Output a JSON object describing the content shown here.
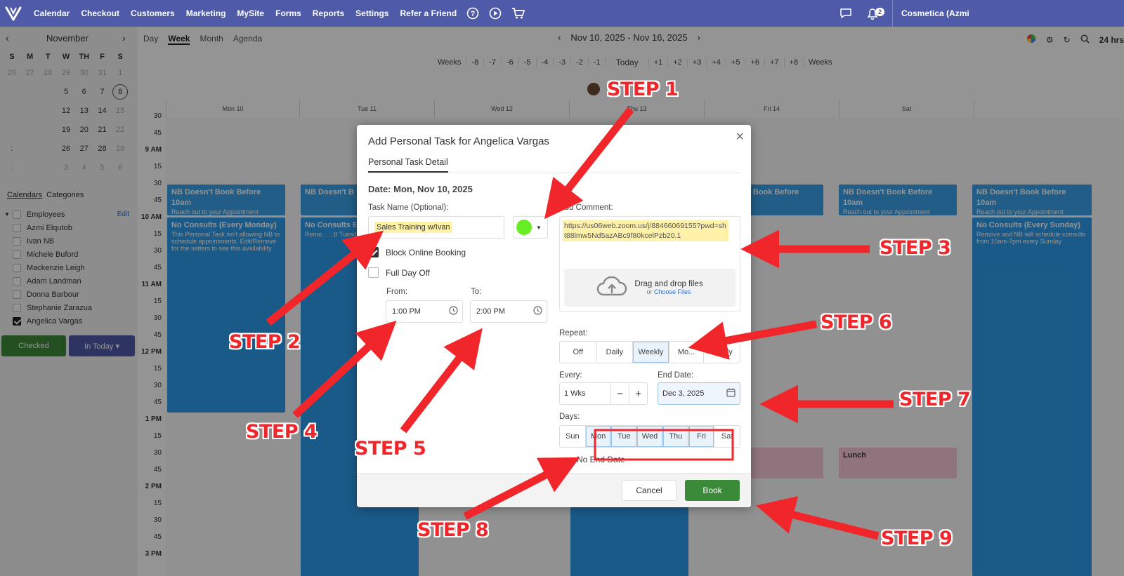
{
  "nav": {
    "items": [
      "Calendar",
      "Checkout",
      "Customers",
      "Marketing",
      "MySite",
      "Forms",
      "Reports",
      "Settings",
      "Refer a Friend"
    ],
    "notif_count": "2",
    "account": "Cosmetica (Azmi"
  },
  "mini_cal": {
    "month": "November",
    "weekdays": [
      "S",
      "M",
      "T",
      "W",
      "TH",
      "F",
      "S"
    ],
    "rows": [
      [
        "26",
        "27",
        "28",
        "29",
        "30",
        "31",
        "1"
      ],
      [
        "",
        "",
        "",
        "5",
        "6",
        "7",
        "8"
      ],
      [
        "",
        "",
        "",
        "12",
        "13",
        "14",
        "15"
      ],
      [
        "",
        "",
        "",
        "19",
        "20",
        "21",
        "22"
      ],
      [
        ":",
        "",
        "",
        "26",
        "27",
        "28",
        "29"
      ],
      [
        ":",
        "",
        "",
        "3",
        "4",
        "5",
        "6"
      ]
    ]
  },
  "sidebar": {
    "tabs": [
      "Calendars",
      "Categories"
    ],
    "group_label": "Employees",
    "edit_label": "Edit",
    "employees": [
      "Azmi Elqutob",
      "Ivan NB",
      "Michele Buford",
      "Mackenzie Leigh",
      "Adam Landman",
      "Donna Barbour",
      "Stephanie Zarazua",
      "Angelica Vargas"
    ],
    "checked_label": "Checked",
    "in_today_label": "In Today ▾"
  },
  "toolbar": {
    "views": [
      "Day",
      "Week",
      "Month",
      "Agenda"
    ],
    "active_view": "Week",
    "date_range": "Nov 10, 2025 - Nov 16, 2025",
    "hours_label": "24 hrs",
    "weeks_nav": [
      "Weeks",
      "-8",
      "-7",
      "-6",
      "-5",
      "-4",
      "-3",
      "-2",
      "-1",
      "Today",
      "+1",
      "+2",
      "+3",
      "+4",
      "+5",
      "+6",
      "+7",
      "+8",
      "Weeks"
    ]
  },
  "days": [
    "Mon 10",
    "Tue 11",
    "Wed 12",
    "Thu 13",
    "Fri 14",
    "Sat",
    ""
  ],
  "time_labels": [
    "30",
    "45",
    "9 AM",
    "15",
    "30",
    "45",
    "10 AM",
    "15",
    "30",
    "45",
    "11 AM",
    "15",
    "30",
    "45",
    "12 PM",
    "15",
    "30",
    "45",
    "1 PM",
    "15",
    "30",
    "45",
    "2 PM",
    "15",
    "30",
    "45",
    "3 PM"
  ],
  "events": {
    "nb_title": "NB Doesn't Book Before 10am",
    "nb_sub": "Reach out to your Appointment",
    "nb_short": "NB Doesn't B",
    "nb_fri": "NB Doesn't Book Before",
    "consult_mon_title": "No Consults (Every Monday)",
    "consult_mon_body": "This Personal Task isn't allowing NB to schedule appointments. Edit/Remove for the setters to see this availability.",
    "consult_tue_title": "No Consults E",
    "consult_tue_body": "Remo... ...tt Tuesday",
    "consult_sun_title": "No Consults (Every Sunday)",
    "consult_sun_body": "Remove and NB will schedule consults from 10am-7pm every Sunday",
    "lunch": "Lunch"
  },
  "modal": {
    "title": "Add Personal Task for Angelica Vargas",
    "tab": "Personal Task Detail",
    "date": "Date: Mon, Nov 10, 2025",
    "task_name_label": "Task Name (Optional):",
    "task_name_value": "Sales Training w/Ivan",
    "block_online": "Block Online Booking",
    "full_day_off": "Full Day Off",
    "from_label": "From:",
    "from_value": "1:00 PM",
    "to_label": "To:",
    "to_value": "2:00 PM",
    "comment_label": "Add Comment:",
    "comment_value": "https://us06web.zoom.us/j/88466069155?pwd=sht88lmw5Nd5azABc9f80kcelPzb20.1",
    "drop_title": "Drag and drop files",
    "drop_or": "or",
    "drop_link": "Choose Files",
    "repeat_label": "Repeat:",
    "repeat_options": [
      "Off",
      "Daily",
      "Weekly",
      "Mo...",
      "Yearly"
    ],
    "every_label": "Every:",
    "every_value": "1 Wks",
    "end_date_label": "End Date:",
    "end_date_value": "Dec 3, 2025",
    "days_label": "Days:",
    "days": [
      "Sun",
      "Mon",
      "Tue",
      "Wed",
      "Thu",
      "Fri",
      "Sat"
    ],
    "no_end_date": "No End Date",
    "cancel": "Cancel",
    "book": "Book"
  },
  "steps": [
    "STEP 1",
    "STEP 2",
    "STEP 3",
    "STEP 4",
    "STEP 5",
    "STEP 6",
    "STEP 7",
    "STEP 8",
    "STEP 9"
  ],
  "colors": {
    "nav": "#4f5aa8",
    "event_blue": "#2e9cea",
    "book_green": "#3a8a3a",
    "step_red": "#f0262a",
    "task_color": "#66ee22"
  }
}
